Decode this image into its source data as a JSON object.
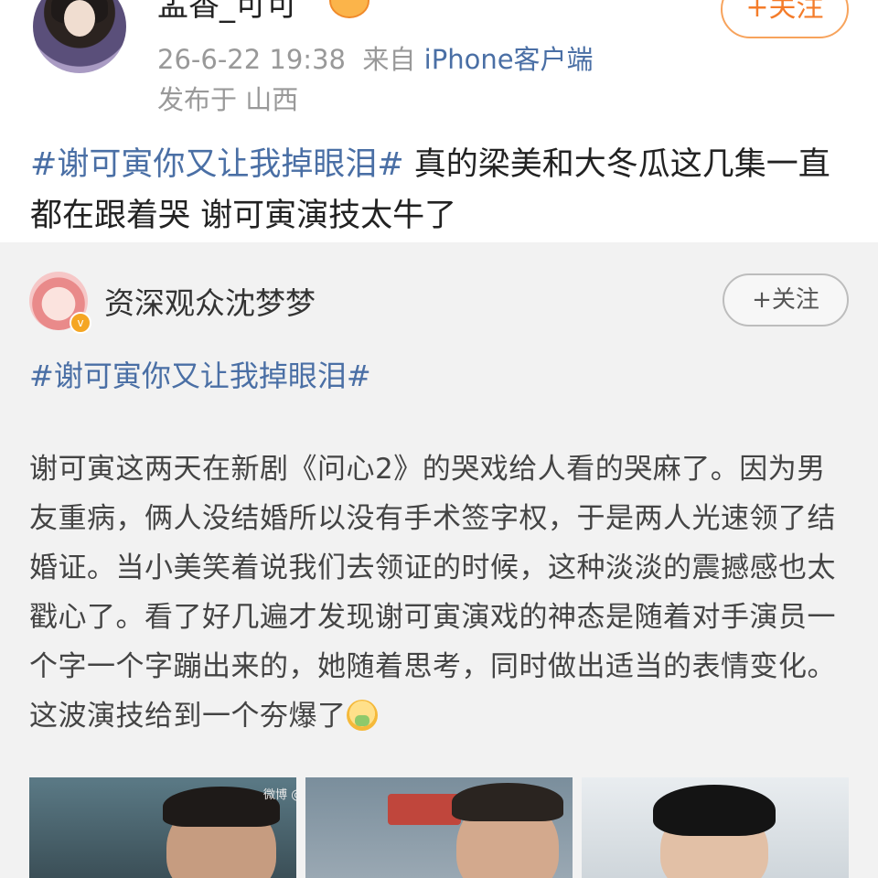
{
  "post": {
    "username": "盂香_可可",
    "follow_label": "+关注",
    "timestamp": "26-6-22 19:38",
    "from_prefix": "来自",
    "client": "iPhone客户端",
    "location": "发布于 山西",
    "hashtag": "#谢可寅你又让我掉眼泪#",
    "text": " 真的梁美和大冬瓜这几集一直都在跟着哭   谢可寅演技太牛了"
  },
  "repost": {
    "username": "资深观众沈梦梦",
    "follow_label": "+关注",
    "hashtag": "#谢可寅你又让我掉眼泪#",
    "body": "谢可寅这两天在新剧《问心2》的哭戏给人看的哭麻了。因为男友重病，俩人没结婚所以没有手术签字权，于是两人光速领了结婚证。当小美笑着说我们去领证的时候，这种淡淡的震撼感也太戳心了。看了好几遍才发现谢可寅演戏的神态是随着对手演员一个字一个字蹦出来的，她随着思考，同时做出适当的表情变化。这波演技给到一个夯爆了",
    "images": [
      {
        "watermark": "微博 @资深"
      },
      {
        "watermark": ""
      },
      {
        "watermark": ""
      }
    ]
  },
  "icons": {
    "user_badge": "emoji-badge-icon",
    "verified": "v-badge-icon",
    "inline_emoji": "sobbing-emoji-icon"
  },
  "colors": {
    "link_blue": "#4a6fa5",
    "follow_orange": "#f47c2a",
    "meta_gray": "#999999",
    "repost_bg": "#f2f2f2"
  }
}
